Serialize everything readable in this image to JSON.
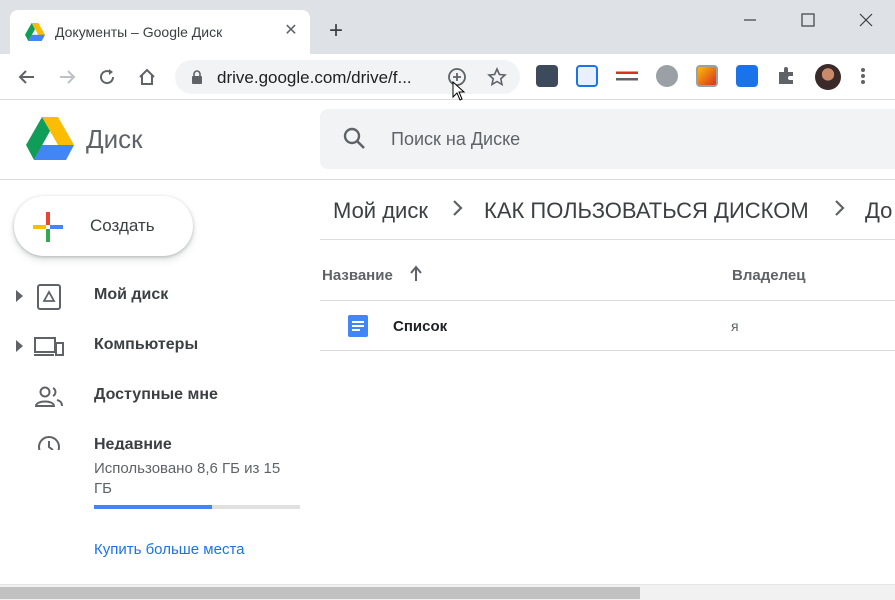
{
  "browser": {
    "tab_title": "Документы – Google Диск",
    "url": "drive.google.com/drive/f...",
    "new_tab_symbol": "+",
    "close_symbol": "✕"
  },
  "drive": {
    "app_name": "Диск",
    "search_placeholder": "Поиск на Диске",
    "create_label": "Создать",
    "nav": [
      {
        "label": "Мой диск",
        "icon": "drive-icon",
        "expandable": true
      },
      {
        "label": "Компьютеры",
        "icon": "computers-icon",
        "expandable": true
      },
      {
        "label": "Доступные мне",
        "icon": "people-icon",
        "expandable": false
      },
      {
        "label": "Недавние",
        "icon": "clock-icon",
        "expandable": false
      }
    ],
    "storage": {
      "text": "Использовано 8,6 ГБ из 15 ГБ",
      "used_fraction": 0.573
    },
    "buy_storage": "Купить больше места",
    "breadcrumb": [
      "Мой диск",
      "КАК ПОЛЬЗОВАТЬСЯ ДИСКОМ",
      "До"
    ],
    "columns": {
      "name": "Название",
      "owner": "Владелец"
    },
    "files": [
      {
        "name": "Список",
        "owner": "я",
        "type": "google-doc"
      }
    ]
  },
  "colors": {
    "accent": "#1a73e8",
    "storage_bar": "#4285f4",
    "doc_blue": "#4285f4"
  }
}
